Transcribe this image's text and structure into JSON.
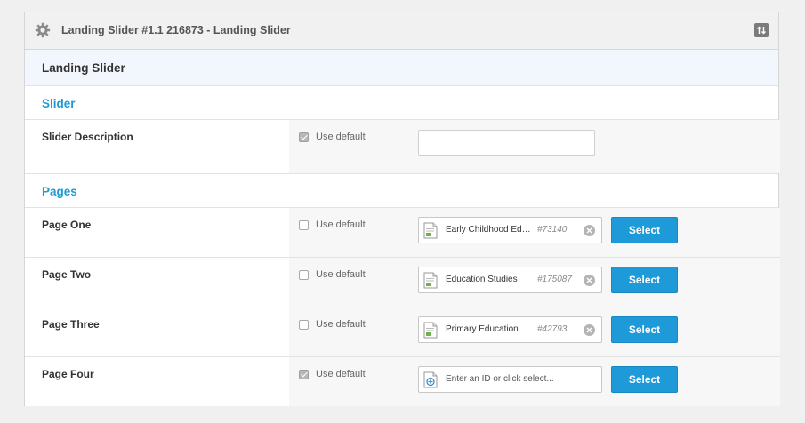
{
  "header": {
    "title": "Landing Slider #1.1 216873 - Landing Slider"
  },
  "section": {
    "title": "Landing Slider"
  },
  "groups": {
    "slider": "Slider",
    "pages": "Pages"
  },
  "fields": {
    "use_default_label": "Use default",
    "slider_description": {
      "label": "Slider Description",
      "use_default": true,
      "value": ""
    },
    "page_one": {
      "label": "Page One",
      "use_default": false,
      "page_name": "Early Childhood Education",
      "page_id": "#73140"
    },
    "page_two": {
      "label": "Page Two",
      "use_default": false,
      "page_name": "Education Studies",
      "page_id": "#175087"
    },
    "page_three": {
      "label": "Page Three",
      "use_default": false,
      "page_name": "Primary Education",
      "page_id": "#42793"
    },
    "page_four": {
      "label": "Page Four",
      "use_default": true,
      "placeholder": "Enter an ID or click select..."
    },
    "select_label": "Select"
  },
  "colors": {
    "accent": "#1f9ad8",
    "group_title": "#1e9ad6",
    "section_bg": "#f2f7fd"
  },
  "icons": [
    "gear-icon",
    "sort-icon",
    "document-icon",
    "clear-icon",
    "link-icon"
  ]
}
